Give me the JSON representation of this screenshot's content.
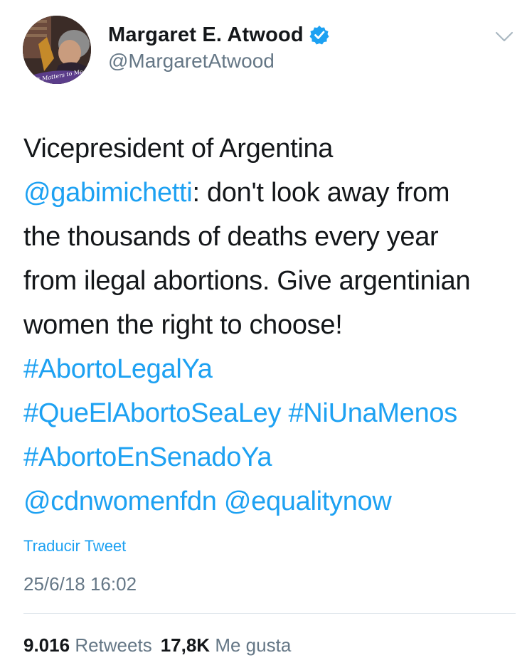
{
  "user": {
    "display_name": "Margaret E. Atwood",
    "handle": "@MargaretAtwood",
    "avatar_caption": "It Matters to Me",
    "verified_icon": "verified-badge-icon"
  },
  "menu_icon": "chevron-down-icon",
  "tweet": {
    "line1": "Vicepresident of Argentina",
    "mention_gabi": "@gabimichetti",
    "line2_rest": ": don't look away from",
    "line3": "the thousands of deaths every year",
    "line4": "from ilegal abortions. Give argentinian",
    "line5": "women the right to choose!",
    "hashtag1": "#AbortoLegalYa",
    "hashtag2": "#QueElAbortoSeaLey",
    "hashtag3": "#NiUnaMenos",
    "hashtag4": "#AbortoEnSenadoYa",
    "mention_cdn": "@cdnwomenfdn",
    "mention_equality": "@equalitynow"
  },
  "translate_label": "Traducir Tweet",
  "timestamp": "25/6/18 16:02",
  "stats": {
    "retweets_count": "9.016",
    "retweets_label": "Retweets",
    "likes_count": "17,8K",
    "likes_label": "Me gusta"
  },
  "colors": {
    "link": "#1da1f2",
    "text": "#14171a",
    "muted": "#657786",
    "divider": "#e1e8ed"
  }
}
